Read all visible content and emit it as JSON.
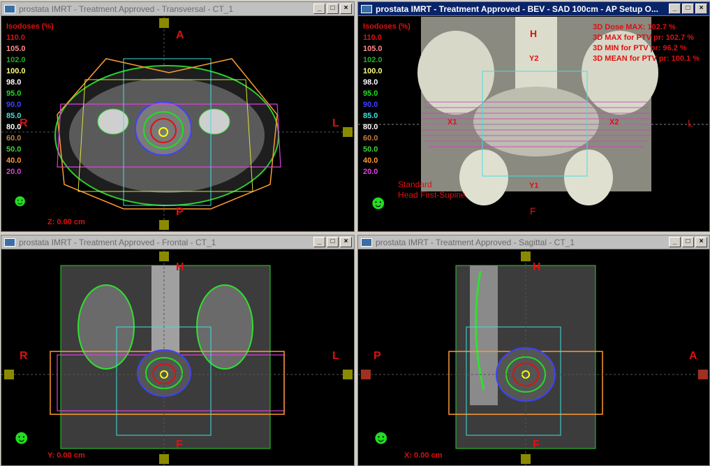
{
  "windows": {
    "transversal": {
      "title": "prostata IMRT  -  Treatment Approved - Transversal - CT_1",
      "status": "Z: 0.00 cm",
      "orient": {
        "top": "A",
        "bottom": "P",
        "left": "R",
        "right": "L"
      }
    },
    "bev": {
      "title": "prostata IMRT  -  Treatment Approved - BEV  -  SAD 100cm  -  AP Setup O...",
      "orient": {
        "top": "H",
        "bottom": "F",
        "right": "L"
      },
      "jaws": {
        "y2": "Y2",
        "y1": "Y1",
        "x1": "X1",
        "x2": "X2"
      },
      "stats": [
        "3D Dose MAX: 102.7 %",
        "3D MAX for PTV pr: 102.7 %",
        "3D MIN for PTV pr: 96.2 %",
        "3D MEAN for PTV pr: 100.1 %"
      ],
      "orientation_text": [
        "Standard",
        "Head First-Supine"
      ]
    },
    "frontal": {
      "title": "prostata IMRT  -  Treatment Approved - Frontal - CT_1",
      "status": "Y: 0.00 cm",
      "orient": {
        "top": "H",
        "bottom": "F",
        "left": "R",
        "right": "L"
      }
    },
    "sagittal": {
      "title": "prostata IMRT  -  Treatment Approved - Sagittal - CT_1",
      "status": "X: 0.00 cm",
      "orient": {
        "top": "H",
        "bottom": "F",
        "left": "P",
        "right": "A"
      }
    }
  },
  "isodoses": {
    "header": "Isodoses (%)",
    "levels": [
      {
        "label": "110.0",
        "color": "#e01010"
      },
      {
        "label": "105.0",
        "color": "#ff8c8c"
      },
      {
        "label": "102.0",
        "color": "#22b022"
      },
      {
        "label": "100.0",
        "color": "#ffff80"
      },
      {
        "label": "98.0",
        "color": "#ffffff"
      },
      {
        "label": "95.0",
        "color": "#22dd22"
      },
      {
        "label": "90.0",
        "color": "#4040ff"
      },
      {
        "label": "85.0",
        "color": "#40e0e0"
      },
      {
        "label": "80.0",
        "color": "#ffffff"
      },
      {
        "label": "60.0",
        "color": "#c08040"
      },
      {
        "label": "50.0",
        "color": "#40d040"
      },
      {
        "label": "40.0",
        "color": "#ff9a30"
      },
      {
        "label": "20.0",
        "color": "#e040e0"
      }
    ]
  },
  "window_buttons": {
    "minimize": "_",
    "maximize": "□",
    "close": "×"
  }
}
